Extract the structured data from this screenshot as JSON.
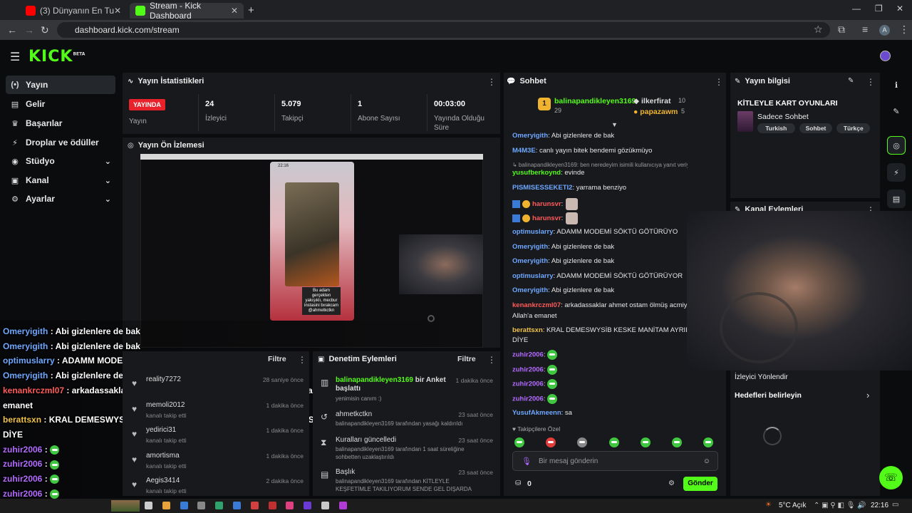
{
  "browser": {
    "tabs": [
      {
        "label": "(3) Dünyanın En Tuhaf Ritüelle...",
        "color": "#ff0000"
      },
      {
        "label": "Stream - Kick Dashboard",
        "color": "#53fc18"
      }
    ],
    "url": "dashboard.kick.com/stream",
    "avatar": "A"
  },
  "kick": {
    "logo": "KICK",
    "beta": "BETA",
    "accent": "#53fc18"
  },
  "sidebar": {
    "items": [
      {
        "label": "Yayın",
        "icon": "(•)"
      },
      {
        "label": "Gelir",
        "icon": "▤"
      },
      {
        "label": "Başarılar",
        "icon": "♛"
      },
      {
        "label": "Droplar ve ödüller",
        "icon": "⚡"
      },
      {
        "label": "Stüdyo",
        "icon": "◉"
      },
      {
        "label": "Kanal",
        "icon": "▣"
      },
      {
        "label": "Ayarlar",
        "icon": "⚙"
      }
    ]
  },
  "stats": {
    "title": "Yayın İstatistikleri",
    "live_badge": "YAYINDA",
    "live_label": "Yayın",
    "viewers": {
      "value": "24",
      "label": "İzleyici"
    },
    "followers": {
      "value": "5.079",
      "label": "Takipçi"
    },
    "subs": {
      "value": "1",
      "label": "Abone Sayısı"
    },
    "uptime": {
      "value": "00:03:00",
      "label": "Yayında Olduğu Süre"
    }
  },
  "preview": {
    "title": "Yayın Ön İzlemesi",
    "phone_time": "22:16",
    "phone_caption": "Bu adam gerçekten yakışıklı, mecbur instasini bırakcam @ahmetkctkn"
  },
  "overlay_chat": [
    {
      "user": "Omeryigith",
      "text": " : Abi gizlenlere de bak",
      "color": "#6ea8ff"
    },
    {
      "user": "Omeryigith",
      "text": " : Abi gizlenlere de bak",
      "color": "#6ea8ff"
    },
    {
      "user": "optimuslarry",
      "text": " : ADAMM MODEMİ SÖKTÜ GÖTÜRÜYOR",
      "color": "#6ea8ff"
    },
    {
      "user": "Omeryigith",
      "text": " : Abi gizlenlere de bak",
      "color": "#6ea8ff"
    },
    {
      "user": "kenankrczml07",
      "text": " : arkadassaklar ahmet ostam ölmüş acmiyo yayini bb Allah'a",
      "color": "#ff5a5a"
    },
    {
      "user": "",
      "text": "emanet",
      "color": "#ffffff"
    },
    {
      "user": "berattsxn",
      "text": " : KRAL DEMESWYSİB KESKE MANİTAM AYRILDI BENDEN REZİLSİN",
      "color": "#f0c24b"
    },
    {
      "user": "",
      "text": "DİYE",
      "color": "#ffffff"
    },
    {
      "user": "zuhir2006",
      "text": " : ",
      "color": "#b46bff"
    },
    {
      "user": "zuhir2006",
      "text": " : ",
      "color": "#b46bff"
    },
    {
      "user": "zuhir2006",
      "text": " : ",
      "color": "#b46bff"
    },
    {
      "user": "zuhir2006",
      "text": " : ",
      "color": "#b46bff"
    },
    {
      "user": "YusufAkmeenn",
      "text": " : sa",
      "color": "#6ea8ff"
    }
  ],
  "followers_panel": {
    "filter": "Filtre",
    "items": [
      {
        "name": "reality7272",
        "sub": "",
        "time": "28 saniye önce"
      },
      {
        "name": "memoli2012",
        "sub": "kanalı takip etti",
        "time": "1 dakika önce"
      },
      {
        "name": "yedirici31",
        "sub": "kanalı takip etti",
        "time": "1 dakika önce"
      },
      {
        "name": "amortisma",
        "sub": "kanalı takip etti",
        "time": "1 dakika önce"
      },
      {
        "name": "Aegis3414",
        "sub": "kanalı takip etti",
        "time": "2 dakika önce"
      }
    ]
  },
  "moderation": {
    "title": "Denetim Eylemleri",
    "filter": "Filtre",
    "items": [
      {
        "user": "balinapandikleyen3169",
        "action": " bir Anket başlattı",
        "sub": "yenimisin canım :)",
        "time": "1 dakika önce"
      },
      {
        "user": "ahmetkctkn",
        "action": "",
        "sub": "balinapandikleyen3169 tarafından yasağı kaldırıldı",
        "time": "23 saat önce"
      },
      {
        "user": "Kuralları güncelledi",
        "action": "",
        "sub": "balinapandikleyen3169 tarafından 1 saat süreliğine sohbetten uzaklaştırıldı",
        "time": "23 saat önce"
      },
      {
        "user": "Başlık",
        "action": "",
        "sub": "balinapandikleyen3169 tarafından KİTLEYLE KEŞFETİMLE TAKILIYORUM SENDE GEL DIŞARDA",
        "time": "23 saat önce"
      }
    ]
  },
  "chat": {
    "title": "Sohbet",
    "top": [
      {
        "rank": "1",
        "name": "balinapandikleyen3169",
        "count": "29"
      },
      {
        "rank": "",
        "name": "ilkerfirat",
        "count": "10"
      },
      {
        "rank": "",
        "name": "papazawm",
        "count": "5"
      }
    ],
    "messages": [
      {
        "user": "Omeryigith",
        "text": ": Abi gizlenlere de bak",
        "cls": "u-blue"
      },
      {
        "user": "M4M3E",
        "text": ": canlı yayın bitek bendemi gözükmüyo",
        "cls": "u-blue"
      },
      {
        "user": "",
        "text": "↳ balinapandikleyen3169: ben neredeyim isimili kullanıcıya yanıt veriyor",
        "cls": "reply"
      },
      {
        "user": "yusufberkoynd",
        "text": ": evinde",
        "cls": "u-grn"
      },
      {
        "user": "PISMISESSEKETI2",
        "text": ": yarrama benziyo",
        "cls": "u-blue"
      },
      {
        "user": "harunsvr",
        "text": ":",
        "cls": "u-red"
      },
      {
        "user": "harunsvr",
        "text": ":",
        "cls": "u-red"
      },
      {
        "user": "optimuslarry",
        "text": ": ADAMM MODEMİ SÖKTÜ GÖTÜRÜYO",
        "cls": "u-blue"
      },
      {
        "user": "Omeryigith",
        "text": ": Abi gizlenlere de bak",
        "cls": "u-blue"
      },
      {
        "user": "Omeryigith",
        "text": ": Abi gizlenlere de bak",
        "cls": "u-blue"
      },
      {
        "user": "optimuslarry",
        "text": ": ADAMM MODEMİ SÖKTÜ GÖTÜRÜYOR",
        "cls": "u-blue"
      },
      {
        "user": "Omeryigith",
        "text": ": Abi gizlenlere de bak",
        "cls": "u-blue"
      },
      {
        "user": "kenankrczml07",
        "text": ": arkadassaklar ahmet ostam ölmüş acmiyo y",
        "cls": "u-red"
      },
      {
        "user": "",
        "text": "Allah'a emanet",
        "cls": ""
      },
      {
        "user": "berattsxn",
        "text": ": KRAL DEMESWYSİB KESKE MANİTAM AYRILDI B",
        "cls": "u-yel"
      },
      {
        "user": "",
        "text": "DİYE",
        "cls": ""
      },
      {
        "user": "zuhir2006",
        "text": ":",
        "cls": "u-pur"
      },
      {
        "user": "zuhir2006",
        "text": ":",
        "cls": "u-pur"
      },
      {
        "user": "zuhir2006",
        "text": ":",
        "cls": "u-pur"
      },
      {
        "user": "zuhir2006",
        "text": ":",
        "cls": "u-pur"
      },
      {
        "user": "YusufAkmeenn",
        "text": ": sa",
        "cls": "u-blue"
      }
    ],
    "follower_only": "Takipçilere Özel",
    "placeholder": "Bir mesaj gönderin",
    "points": "0",
    "send": "Gönder"
  },
  "stream_info": {
    "title": "Yayın bilgisi",
    "stream_title": "KİTLEYLE KART OYUNLARI",
    "category": "Sadece Sohbet",
    "tags": [
      "Turkish",
      "Sohbet",
      "Türkçe"
    ],
    "channel_actions": "Kanal Eylemleri",
    "raid": "İzleyici Yönlendir",
    "goals": "Hedefleri belirleyin"
  },
  "taskbar": {
    "weather": "5°C  Açık",
    "time": "22:16"
  }
}
